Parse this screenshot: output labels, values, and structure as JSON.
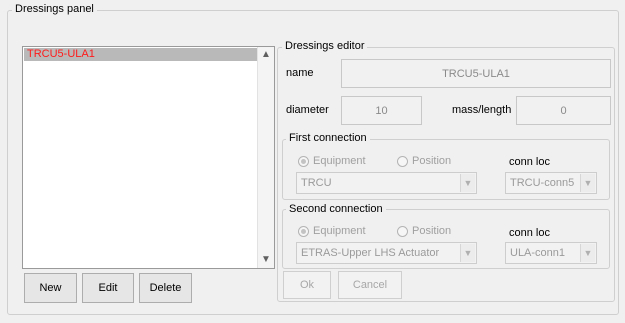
{
  "panel": {
    "title": "Dressings panel"
  },
  "dressings_list": {
    "items": [
      "TRCU5-ULA1"
    ]
  },
  "list_buttons": {
    "new": "New",
    "edit": "Edit",
    "delete": "Delete"
  },
  "editor": {
    "title": "Dressings editor",
    "name_label": "name",
    "name_value": "TRCU5-ULA1",
    "diameter_label": "diameter",
    "diameter_value": "10",
    "mass_label": "mass/length",
    "mass_value": "0",
    "first_connection": {
      "title": "First connection",
      "equipment_label": "Equipment",
      "position_label": "Position",
      "selected": "Equipment",
      "equipment_value": "TRCU",
      "conn_loc_label": "conn loc",
      "conn_loc_value": "TRCU-conn5"
    },
    "second_connection": {
      "title": "Second connection",
      "equipment_label": "Equipment",
      "position_label": "Position",
      "selected": "Equipment",
      "equipment_value": "ETRAS-Upper LHS Actuator",
      "conn_loc_label": "conn loc",
      "conn_loc_value": "ULA-conn1"
    },
    "ok_label": "Ok",
    "cancel_label": "Cancel"
  },
  "colors": {
    "selected_item_text": "#ff1a1a",
    "selected_item_bg": "#b9b9b9"
  }
}
